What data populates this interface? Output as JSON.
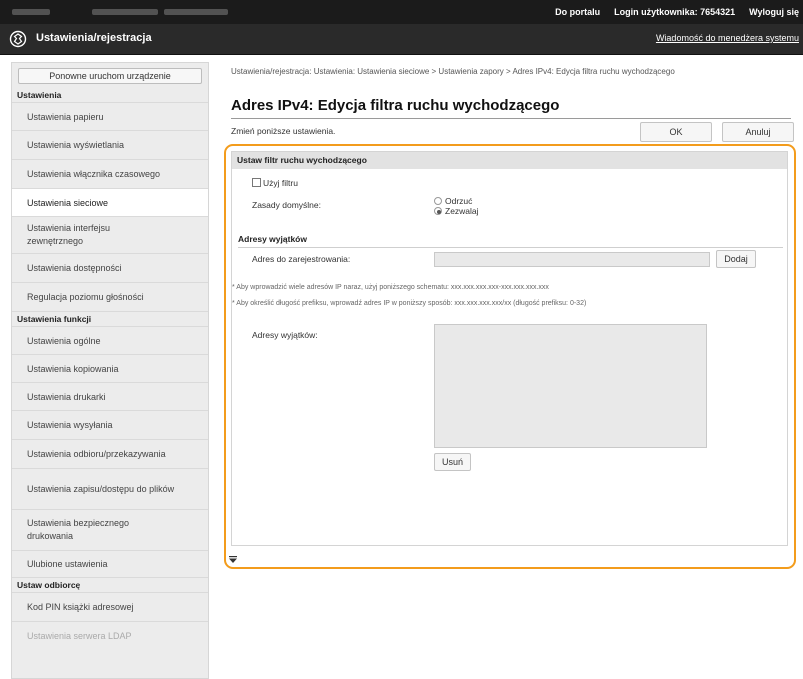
{
  "topbar": {
    "portal_link": "Do portalu",
    "login_label": "Login użytkownika:",
    "login_value": "7654321",
    "logout_link": "Wyloguj się"
  },
  "header": {
    "title": "Ustawienia/rejestracja",
    "message_link": "Wiadomość do menedżera systemu"
  },
  "sidebar": {
    "restart_button": "Ponowne uruchom urządzenie",
    "section_settings": "Ustawienia",
    "items_a": [
      {
        "label": "Ustawienia papieru"
      },
      {
        "label": "Ustawienia wyświetlania"
      },
      {
        "label": "Ustawienia włącznika czasowego"
      },
      {
        "label": "Ustawienia sieciowe"
      },
      {
        "label": "Ustawienia interfejsu zewnętrznego"
      },
      {
        "label": "Ustawienia dostępności"
      },
      {
        "label": "Regulacja poziomu głośności"
      }
    ],
    "section_functions": "Ustawienia funkcji",
    "items_b": [
      {
        "label": "Ustawienia ogólne"
      },
      {
        "label": "Ustawienia kopiowania"
      },
      {
        "label": "Ustawienia drukarki"
      },
      {
        "label": "Ustawienia wysyłania"
      },
      {
        "label": "Ustawienia odbioru/przekazywania"
      },
      {
        "label": "Ustawienia zapisu/dostępu do plików"
      },
      {
        "label": "Ustawienia bezpiecznego drukowania"
      },
      {
        "label": "Ulubione ustawienia"
      }
    ],
    "section_recipients": "Ustaw odbiorcę",
    "items_c": [
      {
        "label": "Kod PIN książki adresowej"
      },
      {
        "label": "Ustawienia serwera LDAP"
      }
    ]
  },
  "main": {
    "breadcrumb": "Ustawienia/rejestracja: Ustawienia: Ustawienia sieciowe > Ustawienia zapory > Adres IPv4: Edycja filtra ruchu wychodzącego",
    "page_title": "Adres IPv4: Edycja filtra ruchu wychodzącego",
    "description": "Zmień poniższe ustawienia.",
    "ok_button": "OK",
    "cancel_button": "Anuluj"
  },
  "filter": {
    "section_title": "Ustaw filtr ruchu wychodzącego",
    "use_filter_label": "Użyj filtru",
    "use_filter_checked": false,
    "default_policy_label": "Zasady domyślne:",
    "policy_options": [
      "Odrzuć",
      "Zezwalaj"
    ],
    "policy_selected": "Zezwalaj",
    "exceptions_header": "Adresy wyjątków",
    "address_to_register_label": "Adres do zarejestrowania:",
    "address_value": "",
    "add_button": "Dodaj",
    "note_1": "* Aby wprowadzić wiele adresów IP naraz, użyj poniższego schematu: xxx.xxx.xxx.xxx-xxx.xxx.xxx.xxx",
    "note_2": "* Aby określić długość prefiksu, wprowadź adres IP w poniższy sposób: xxx.xxx.xxx.xxx/xx (długość prefiksu: 0-32)",
    "exceptions_label": "Adresy wyjątków:",
    "exceptions_list": [],
    "remove_button": "Usuń"
  },
  "colors": {
    "highlight": "#f39c1c",
    "header_bg": "#2a2a2a",
    "topbar_bg": "#1b1b1b"
  }
}
